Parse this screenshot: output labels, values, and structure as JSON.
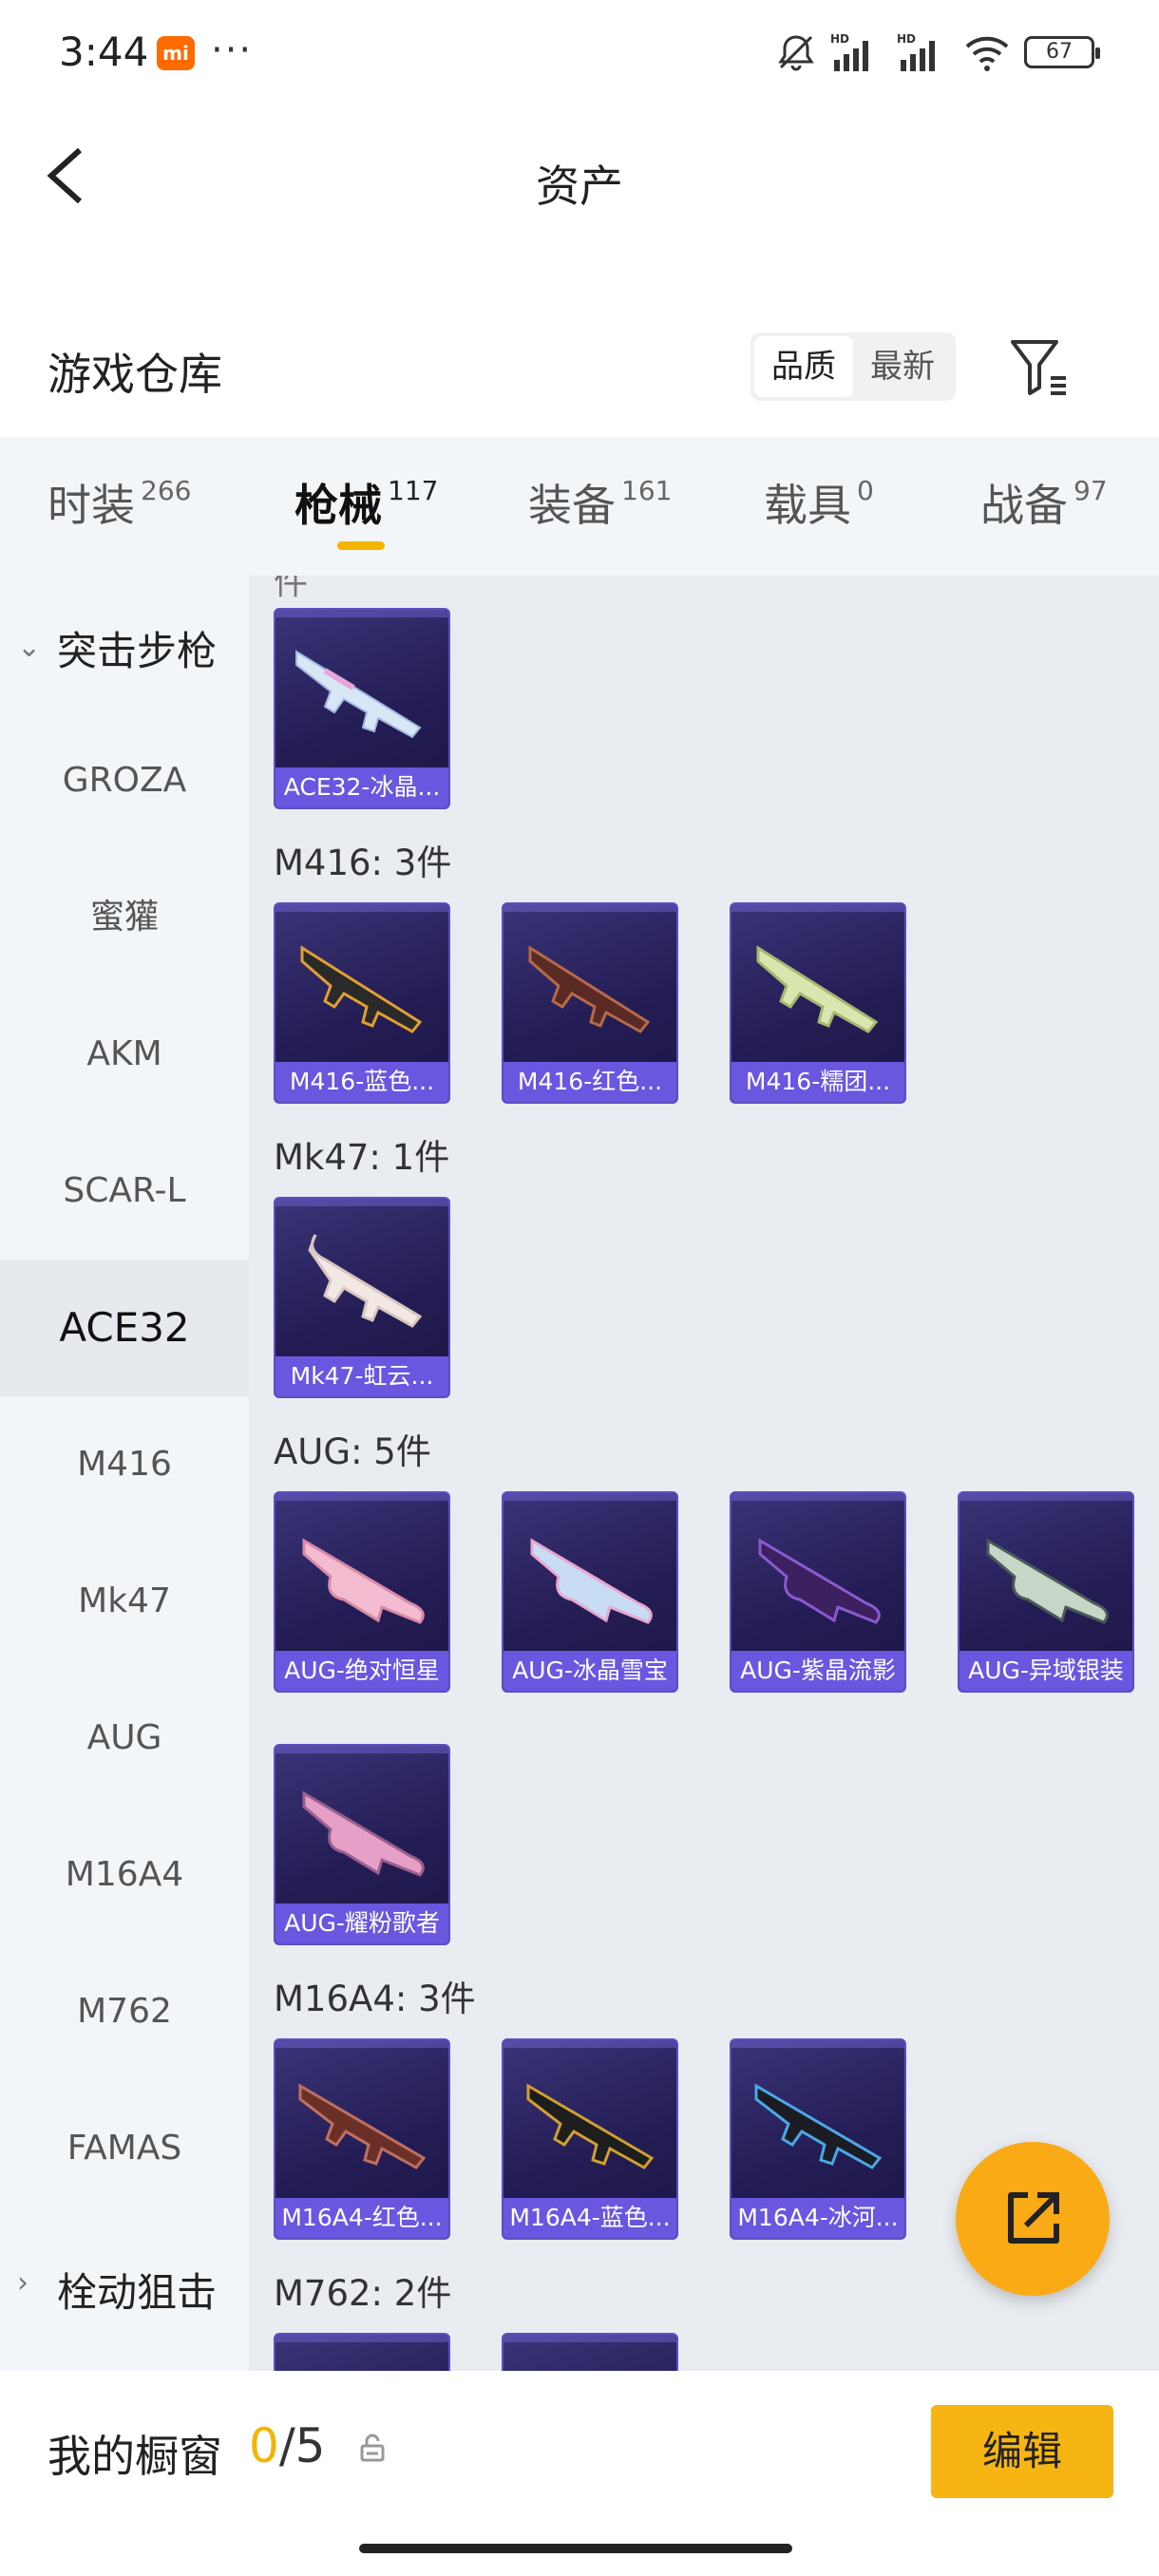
{
  "status": {
    "time": "3:44",
    "app_badge": "mi",
    "dots": "···",
    "battery": "67"
  },
  "header": {
    "title": "资产"
  },
  "warehouse": {
    "title": "游戏仓库",
    "sort_options": [
      "品质",
      "最新"
    ]
  },
  "tabs": [
    {
      "label": "时装",
      "count": "266"
    },
    {
      "label": "枪械",
      "count": "117"
    },
    {
      "label": "装备",
      "count": "161"
    },
    {
      "label": "载具",
      "count": "0"
    },
    {
      "label": "战备",
      "count": "97"
    }
  ],
  "sidebar": {
    "group_expanded": "突击步枪",
    "items": [
      "GROZA",
      "蜜獾",
      "AKM",
      "SCAR-L",
      "ACE32",
      "M416",
      "Mk47",
      "AUG",
      "M16A4",
      "M762",
      "FAMAS"
    ],
    "active_item": "ACE32",
    "group_collapsed": "栓动狙击"
  },
  "content": {
    "cut_header": "件",
    "sections": [
      {
        "label": "",
        "items": [
          "ACE32-冰晶..."
        ]
      },
      {
        "label": "M416: 3件",
        "items": [
          "M416-蓝色...",
          "M416-红色...",
          "M416-糯团..."
        ]
      },
      {
        "label": "Mk47: 1件",
        "items": [
          "Mk47-虹云..."
        ]
      },
      {
        "label": "AUG: 5件",
        "items": [
          "AUG-绝对恒星",
          "AUG-冰晶雪宝",
          "AUG-紫晶流影",
          "AUG-异域银装",
          "AUG-耀粉歌者"
        ]
      },
      {
        "label": "M16A4: 3件",
        "items": [
          "M16A4-红色...",
          "M16A4-蓝色...",
          "M16A4-冰河..."
        ]
      },
      {
        "label": "M762: 2件",
        "items": []
      }
    ]
  },
  "bottom": {
    "showcase_label": "我的橱窗",
    "showcase_current": "0",
    "showcase_total": "/5",
    "edit_label": "编辑"
  },
  "colors": {
    "accent": "#f5b400",
    "card_label": "#6a57e0",
    "card_bg": "#241d55"
  }
}
